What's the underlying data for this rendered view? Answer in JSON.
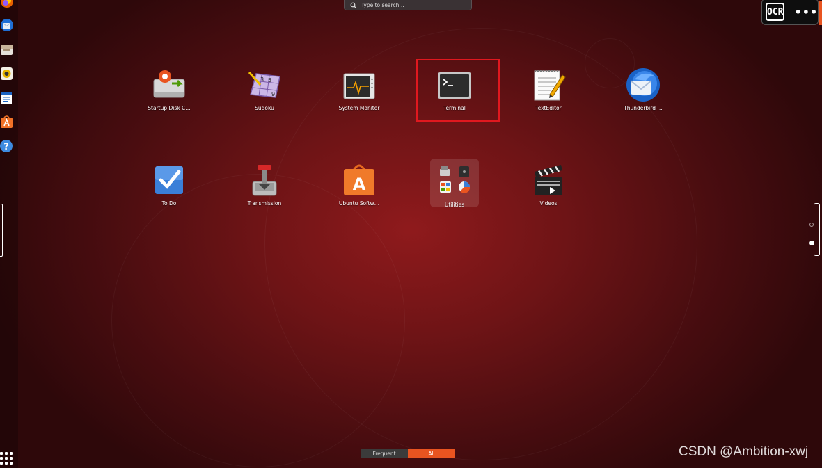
{
  "search": {
    "placeholder": "Type to search…"
  },
  "overlay": {
    "ocr_label": "OCR",
    "more_label": "•••"
  },
  "apps_row1": [
    {
      "label": "Startup Disk C…",
      "icon": "startup-disk-icon"
    },
    {
      "label": "Sudoku",
      "icon": "sudoku-icon"
    },
    {
      "label": "System Monitor",
      "icon": "system-monitor-icon"
    },
    {
      "label": "Terminal",
      "icon": "terminal-icon"
    },
    {
      "label": "TextEditor",
      "icon": "text-editor-icon"
    },
    {
      "label": "Thunderbird …",
      "icon": "thunderbird-icon"
    }
  ],
  "apps_row2": [
    {
      "label": "To Do",
      "icon": "todo-icon"
    },
    {
      "label": "Transmission",
      "icon": "transmission-icon"
    },
    {
      "label": "Ubuntu Softw…",
      "icon": "ubuntu-software-icon"
    },
    {
      "label": "Utilities",
      "icon": "utilities-folder-icon"
    },
    {
      "label": "Videos",
      "icon": "videos-icon"
    }
  ],
  "sudoku_digits": [
    "3",
    "5",
    "9"
  ],
  "software_letter": "A",
  "dock": {
    "items": [
      "firefox-icon",
      "thunderbird-icon",
      "files-icon",
      "rhythmbox-icon",
      "writer-icon",
      "software-icon",
      "help-icon"
    ],
    "help_glyph": "?"
  },
  "switcher": {
    "frequent_label": "Frequent",
    "all_label": "All",
    "active": "All"
  },
  "watermark": "CSDN @Ambition-xwj",
  "colors": {
    "accent": "#e95420",
    "highlight": "#e0181f",
    "background": "#6f1416"
  }
}
